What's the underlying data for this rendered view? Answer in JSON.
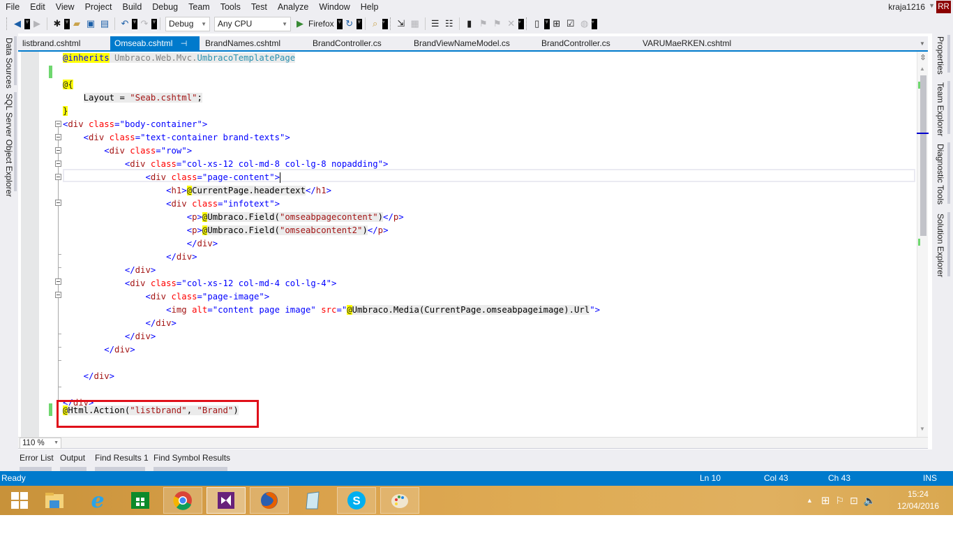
{
  "menu": {
    "items": [
      "File",
      "Edit",
      "View",
      "Project",
      "Build",
      "Debug",
      "Team",
      "Tools",
      "Test",
      "Analyze",
      "Window",
      "Help"
    ],
    "user": "kraja1216",
    "avatar_initials": "RR",
    "avatar_color": "#8b0000"
  },
  "toolbar": {
    "config": "Debug",
    "platform": "Any CPU",
    "run_target": "Firefox",
    "icons": [
      "back-icon",
      "forward-icon",
      "new-project-icon",
      "open-file-icon",
      "save-icon",
      "save-all-icon",
      "undo-icon",
      "redo-icon",
      "start-icon",
      "refresh-icon",
      "find-in-files-icon",
      "step-into-icon",
      "toggle-panel-icon",
      "comment-icon",
      "uncomment-icon",
      "bookmark-icon",
      "prev-bookmark-icon",
      "next-bookmark-icon",
      "clear-bookmarks-icon",
      "file-properties-icon",
      "new-item-icon",
      "publish-icon",
      "web-icon"
    ]
  },
  "left_panels": [
    "Data Sources",
    "SQL Server Object Explorer"
  ],
  "right_panels": [
    "Properties",
    "Team Explorer",
    "Diagnostic Tools",
    "Solution Explorer"
  ],
  "tabs": [
    {
      "label": "listbrand.cshtml",
      "active": false
    },
    {
      "label": "Omseab.cshtml",
      "active": true
    },
    {
      "label": "BrandNames.cshtml",
      "active": false
    },
    {
      "label": "BrandController.cs",
      "active": false
    },
    {
      "label": "BrandViewNameModel.cs",
      "active": false
    },
    {
      "label": "BrandController.cs",
      "active": false
    },
    {
      "label": "VARUMaeRKEN.cshtml",
      "active": false
    }
  ],
  "code": {
    "l1_kw": "@inherits",
    "l1_ns": "Umbraco.Web.Mvc.",
    "l1_type": "UmbracoTemplatePage",
    "l3": "@{",
    "l4_a": "Layout = ",
    "l4_str": "\"Seab.cshtml\"",
    "l4_b": ";",
    "l5": "}",
    "body_container": "body-container",
    "text_container": "text-container brand-texts",
    "row": "row",
    "col8": "col-xs-12 col-md-8 col-lg-8 nopadding",
    "page_content": "page-content",
    "h1_expr": "CurrentPage.headertext",
    "infotext": "infotext",
    "field1": "\"omseabpagecontent\"",
    "field2": "\"omseabcontent2\"",
    "col4": "col-xs-12 col-md-4 col-lg-4",
    "page_image": "page-image",
    "img_alt": "\"content page image\"",
    "img_src_expr": "Umbraco.Media(CurrentPage.omseabpageimage).Url",
    "action_call": "Html.Action(",
    "action_arg1": "\"listbrand\"",
    "action_sep": ", ",
    "action_arg2": "\"Brand\"",
    "action_close": ")"
  },
  "zoom_level": "110 %",
  "bottom_tabs": [
    "Error List",
    "Output",
    "Find Results 1",
    "Find Symbol Results"
  ],
  "status": {
    "text": "Ready",
    "line": "Ln 10",
    "col": "Col 43",
    "ch": "Ch 43",
    "mode": "INS",
    "bg_color": "#007acc"
  },
  "taskbar": {
    "apps": [
      "Start",
      "File Explorer",
      "Internet Explorer",
      "Store",
      "Chrome",
      "Visual Studio",
      "Firefox",
      "Notepad",
      "Skype",
      "Paint"
    ],
    "time": "15:24",
    "date": "12/04/2016"
  }
}
